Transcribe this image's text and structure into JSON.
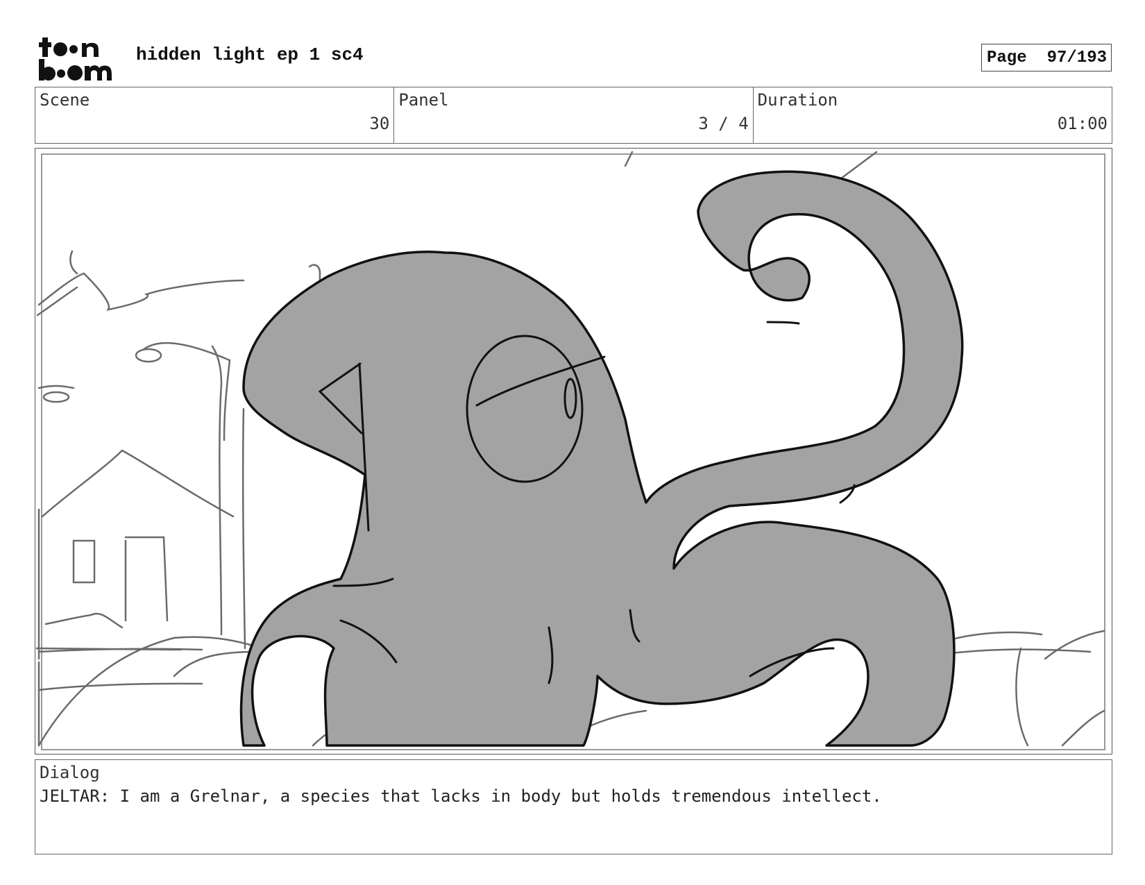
{
  "header": {
    "logo_text": "toon boom",
    "title": "hidden light ep 1 sc4",
    "page_label": "Page",
    "page_value": "97/193"
  },
  "info": {
    "scene_label": "Scene",
    "scene_value": "30",
    "panel_label": "Panel",
    "panel_value": "3 / 4",
    "duration_label": "Duration",
    "duration_value": "01:00"
  },
  "panel_image": {
    "icon": "storyboard-sketch",
    "subject": "grey tentacled creature in front of a street lamp and building sketch"
  },
  "dialog": {
    "label": "Dialog",
    "text": "JELTAR: I am a Grelnar, a species that lacks in body but holds tremendous intellect."
  }
}
